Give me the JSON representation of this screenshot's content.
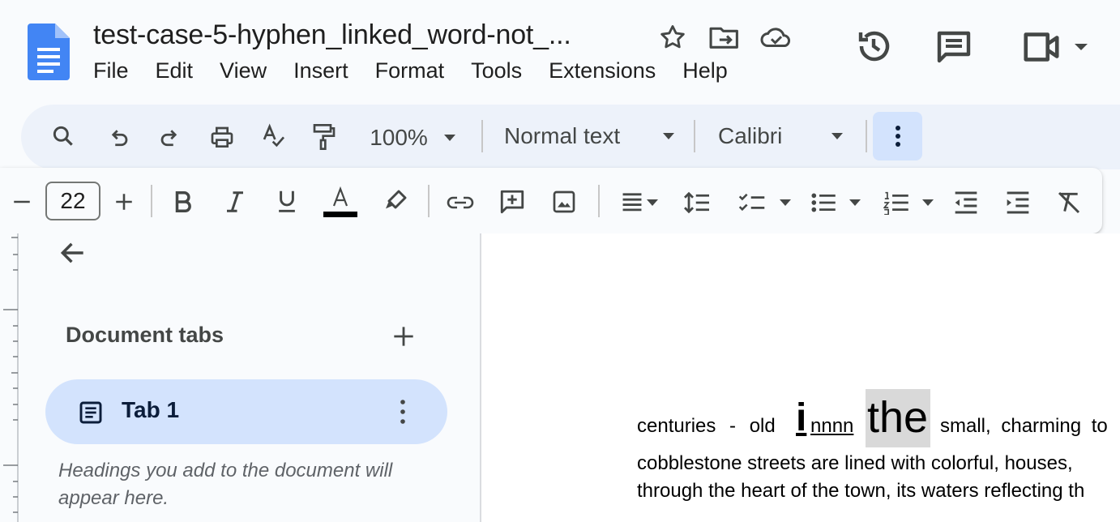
{
  "header": {
    "title": "test-case-5-hyphen_linked_word-not_...",
    "menu": [
      "File",
      "Edit",
      "View",
      "Insert",
      "Format",
      "Tools",
      "Extensions",
      "Help"
    ],
    "icons": [
      "docs-logo-icon",
      "star-icon",
      "move-to-folder-icon",
      "cloud-saved-icon",
      "version-history-icon",
      "comments-icon",
      "meet-icon",
      "dropdown-caret-icon"
    ]
  },
  "toolbar": {
    "zoom": "100%",
    "style": "Normal text",
    "font": "Calibri",
    "icons": [
      "search-icon",
      "undo-icon",
      "redo-icon",
      "print-icon",
      "spellcheck-icon",
      "paint-format-icon",
      "more-vert-icon"
    ]
  },
  "format_bar": {
    "font_size": "22",
    "text_color": "#000000",
    "icons": [
      "decrease-font-size-icon",
      "increase-font-size-icon",
      "bold-icon",
      "italic-icon",
      "underline-icon",
      "text-color-icon",
      "highlight-icon",
      "link-icon",
      "add-comment-icon",
      "insert-image-icon",
      "align-justify-icon",
      "line-spacing-icon",
      "checklist-icon",
      "bulleted-list-icon",
      "numbered-list-icon",
      "decrease-indent-icon",
      "increase-indent-icon",
      "clear-formatting-icon"
    ]
  },
  "side_panel": {
    "heading": "Document tabs",
    "tabs": [
      {
        "label": "Tab 1"
      }
    ],
    "hint": "Headings you add to the document will appear here."
  },
  "document": {
    "line1": {
      "before": "centuries - old",
      "big_letter": "i",
      "underlined": "nnnn",
      "highlighted": "the",
      "after": "small, charming to"
    },
    "line2": "cobblestone streets are lined with colorful, houses,",
    "line3": "through the heart of the town, its waters reflecting th",
    "highlight_color": "#d9d9d9"
  }
}
